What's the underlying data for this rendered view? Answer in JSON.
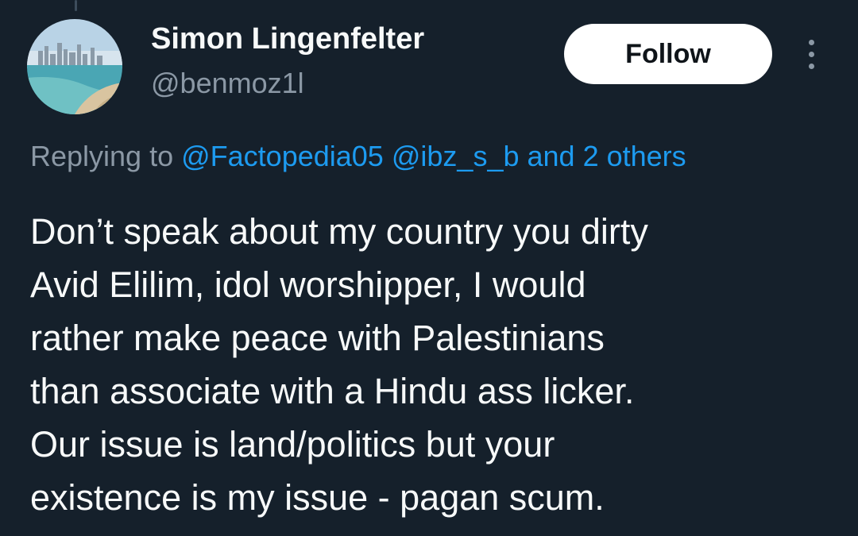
{
  "user": {
    "display_name": "Simon Lingenfelter",
    "handle": "@benmoz1l",
    "avatar": "beach-city-skyline-photo"
  },
  "actions": {
    "follow_label": "Follow",
    "more_icon": "more-vertical-icon"
  },
  "reply": {
    "prefix": "Replying to",
    "mentions": [
      "@Factopedia05",
      "@ibz_s_b"
    ],
    "suffix": "and 2 others"
  },
  "tweet": {
    "lines": [
      "Don’t speak about my country you dirty",
      "Avid Elilim, idol worshipper, I would",
      "rather make peace with Palestinians",
      "than associate with a Hindu ass licker.",
      "Our issue is land/politics but your",
      "existence is my issue - pagan scum."
    ]
  },
  "colors": {
    "background": "#15202b",
    "text": "#f7f9f9",
    "secondary": "#8b98a5",
    "accent": "#1d9bf0",
    "button_bg": "#ffffff"
  }
}
